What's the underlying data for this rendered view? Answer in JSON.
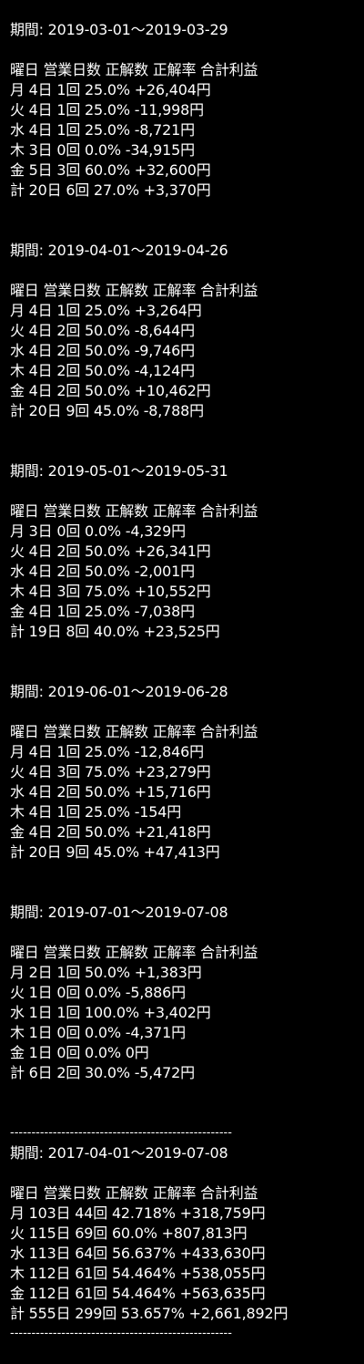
{
  "colors": {
    "background": "#000000",
    "text": "#ffffff"
  },
  "lines": [
    "期間: 2019-03-01〜2019-03-29",
    "曜日 営業日数 正解数 正解率 合計利益",
    "月 4日 1回 25.0% +26,404円",
    "火 4日 1回 25.0% -11,998円",
    "水 4日 1回 25.0% -8,721円",
    "木 3日 0回 0.0% -34,915円",
    "金 5日 3回 60.0% +32,600円",
    "計 20日 6回 27.0% +3,370円",
    "期間: 2019-04-01〜2019-04-26",
    "曜日 営業日数 正解数 正解率 合計利益",
    "月 4日 1回 25.0% +3,264円",
    "火 4日 2回 50.0% -8,644円",
    "水 4日 2回 50.0% -9,746円",
    "木 4日 2回 50.0% -4,124円",
    "金 4日 2回 50.0% +10,462円",
    "計 20日 9回 45.0% -8,788円",
    "期間: 2019-05-01〜2019-05-31",
    "曜日 営業日数 正解数 正解率 合計利益",
    "月 3日 0回 0.0% -4,329円",
    "火 4日 2回 50.0% +26,341円",
    "水 4日 2回 50.0% -2,001円",
    "木 4日 3回 75.0% +10,552円",
    "金 4日 1回 25.0% -7,038円",
    "計 19日 8回 40.0% +23,525円",
    "期間: 2019-06-01〜2019-06-28",
    "曜日 営業日数 正解数 正解率 合計利益",
    "月 4日 1回 25.0% -12,846円",
    "火 4日 3回 75.0% +23,279円",
    "水 4日 2回 50.0% +15,716円",
    "木 4日 1回 25.0% -154円",
    "金 4日 2回 50.0% +21,418円",
    "計 20日 9回 45.0% +47,413円",
    "期間: 2019-07-01〜2019-07-08",
    "曜日 営業日数 正解数 正解率 合計利益",
    "月 2日 1回 50.0% +1,383円",
    "火 1日 0回 0.0% -5,886円",
    "水 1日 1回 100.0% +3,402円",
    "木 1日 0回 0.0% -4,371円",
    "金 1日 0回 0.0% 0円",
    "計 6日 2回 30.0% -5,472円",
    "----------------------------------------------------",
    "期間: 2017-04-01〜2019-07-08",
    "曜日 営業日数 正解数 正解率 合計利益",
    "月 103日 44回 42.718% +318,759円",
    "火 115日 69回 60.0% +807,813円",
    "水 113日 64回 56.637% +433,630円",
    "木 112日 61回 54.464% +538,055円",
    "金 112日 61回 54.464% +563,635円",
    "計 555日 299回 53.657% +2,661,892円",
    "----------------------------------------------------"
  ]
}
